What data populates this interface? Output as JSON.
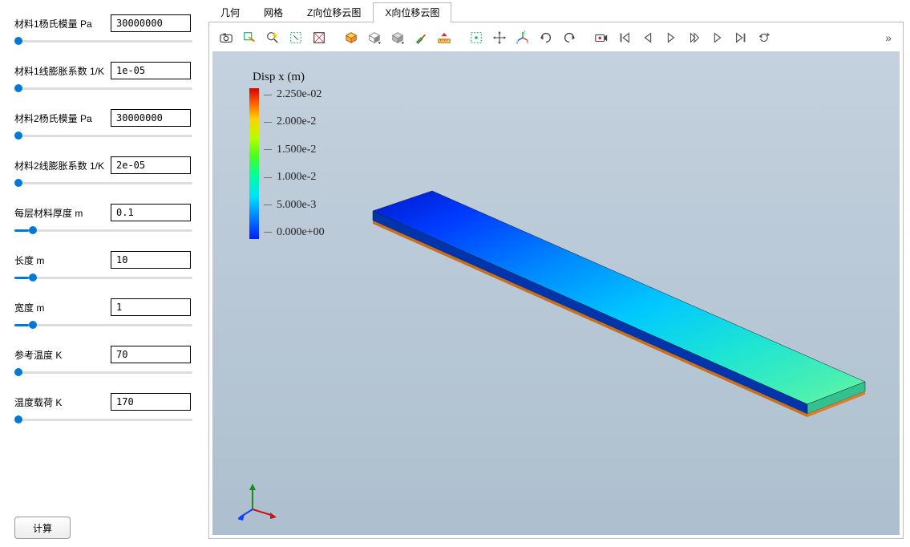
{
  "params": [
    {
      "label": "材料1杨氏模量 Pa",
      "value": "30000000",
      "slider_pct": "0%"
    },
    {
      "label": "材料1线膨胀系数 1/K",
      "value": "1e-05",
      "slider_pct": "0%"
    },
    {
      "label": "材料2杨氏模量 Pa",
      "value": "30000000",
      "slider_pct": "0%"
    },
    {
      "label": "材料2线膨胀系数 1/K",
      "value": "2e-05",
      "slider_pct": "0%"
    },
    {
      "label": "每层材料厚度 m",
      "value": "0.1",
      "slider_pct": "8%"
    },
    {
      "label": "长度 m",
      "value": "10",
      "slider_pct": "8%"
    },
    {
      "label": "宽度 m",
      "value": "1",
      "slider_pct": "8%"
    },
    {
      "label": "参考温度 K",
      "value": "70",
      "slider_pct": "0%"
    },
    {
      "label": "温度载荷 K",
      "value": "170",
      "slider_pct": "0%"
    }
  ],
  "compute_label": "计算",
  "tabs": [
    {
      "label": "几何",
      "active": false
    },
    {
      "label": "网格",
      "active": false
    },
    {
      "label": "Z向位移云图",
      "active": false
    },
    {
      "label": "X向位移云图",
      "active": true
    }
  ],
  "toolbar_icons": [
    "camera-icon",
    "export-icon",
    "zoom-bolt-icon",
    "rubber-band-zoom-icon",
    "reset-icon",
    "isometric-icon",
    "view-dropdown-icon",
    "solid-dropdown-icon",
    "brush-icon",
    "ruler-icon",
    "select-region-icon",
    "move-icon",
    "axis-nav-icon",
    "rotate-cw-icon",
    "rotate-ccw-icon",
    "record-icon",
    "first-frame-icon",
    "prev-frame-icon",
    "play-icon",
    "play-end-icon",
    "next-frame-icon",
    "last-frame-icon",
    "loop-icon"
  ],
  "legend": {
    "title": "Disp x (m)",
    "ticks": [
      "2.250e-02",
      "2.000e-2",
      "1.500e-2",
      "1.000e-2",
      "5.000e-3",
      "0.000e+00"
    ]
  },
  "overflow": "»"
}
